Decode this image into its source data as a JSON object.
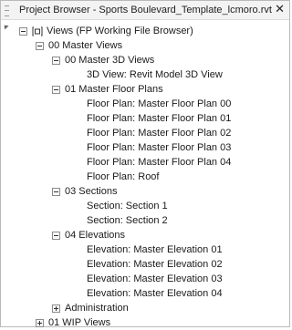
{
  "window": {
    "title": "Project Browser - Sports Boulevard_Template_lcmoro.rvt",
    "close_glyph": "✕"
  },
  "tree": {
    "root": {
      "label": "Views (FP Working File Browser)",
      "icon": "views-icon"
    },
    "master_views": {
      "label": "00 Master Views"
    },
    "master_3d": {
      "label": "00 Master 3D Views",
      "items": [
        "3D View: Revit Model 3D View"
      ]
    },
    "master_floor_plans": {
      "label": "01 Master Floor Plans",
      "items": [
        "Floor Plan: Master Floor Plan 00",
        "Floor Plan: Master Floor Plan 01",
        "Floor Plan: Master Floor Plan 02",
        "Floor Plan: Master Floor Plan 03",
        "Floor Plan: Master Floor Plan 04",
        "Floor Plan: Roof"
      ]
    },
    "sections": {
      "label": "03 Sections",
      "items": [
        "Section: Section 1",
        "Section: Section 2"
      ]
    },
    "elevations": {
      "label": "04 Elevations",
      "items": [
        "Elevation: Master Elevation 01",
        "Elevation: Master Elevation 02",
        "Elevation: Master Elevation 03",
        "Elevation: Master Elevation 04"
      ]
    },
    "administration": {
      "label": "Administration"
    },
    "wip_views": {
      "label": "01 WIP Views"
    }
  }
}
